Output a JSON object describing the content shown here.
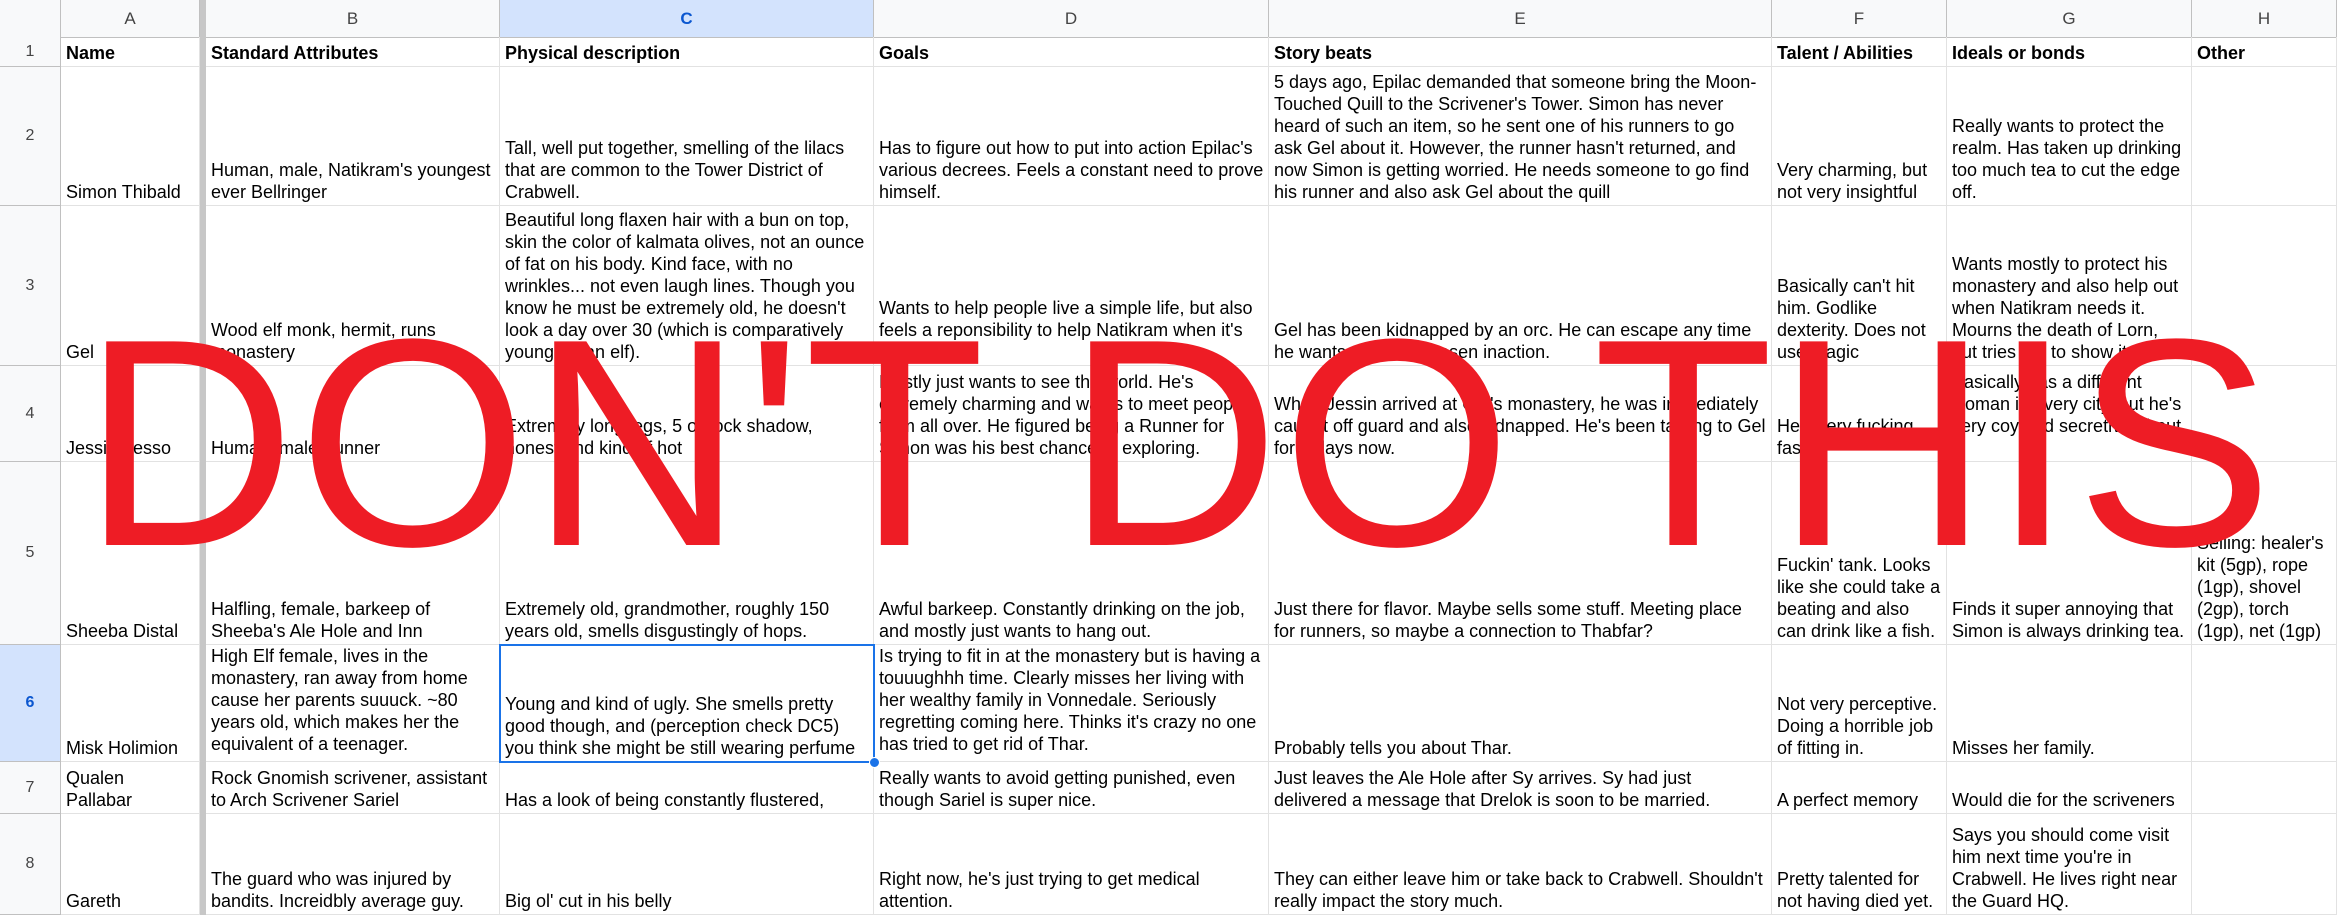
{
  "columns": [
    "A",
    "B",
    "C",
    "D",
    "E",
    "F",
    "G",
    "H"
  ],
  "selected_column": "C",
  "selected_row": "6",
  "header_row": {
    "row_number": "1",
    "cells": [
      "Name",
      "Standard Attributes",
      "Physical description",
      "Goals",
      "Story beats",
      "Talent / Abilities",
      "Ideals or bonds",
      "Other"
    ]
  },
  "rows": [
    {
      "row_number": "2",
      "cells": [
        "Simon Thibald",
        "Human, male, Natikram's youngest ever Bellringer",
        "Tall, well put together, smelling of the lilacs that are common to the Tower District of Crabwell.",
        "Has to figure out how to put into action Epilac's various decrees. Feels a constant need to prove himself.",
        "5 days ago, Epilac demanded that someone bring the Moon-Touched Quill to the Scrivener's Tower. Simon has never heard of such an item, so he sent one of his runners to go ask Gel about it. However, the runner hasn't returned, and now Simon is getting worried. He needs someone to go find his runner and also ask Gel about the quill",
        "Very charming, but not very insightful",
        "Really wants to protect the realm. Has taken up drinking too much tea to cut the edge off.",
        ""
      ]
    },
    {
      "row_number": "3",
      "cells": [
        "Gel",
        "Wood elf monk, hermit, runs monastery",
        "Beautiful long flaxen hair with a bun on top, skin the color of kalmata olives, not an ounce of fat on his body. Kind face, with no wrinkles... not even laugh lines. Though you know he must be extremely old, he doesn't look a day over 30 (which is comparatively young for an elf).",
        "Wants to help people live a simple life, but also feels a reponsibility to help Natikram when it's needed.",
        "Gel has been kidnapped by an orc. He can escape any time he wants, but has chosen inaction.",
        "Basically can't hit him. Godlike dexterity. Does not use magic",
        "Wants mostly to protect his monastery and also help out when Natikram needs it. Mourns the death of Lorn, but tries not to show it.",
        ""
      ]
    },
    {
      "row_number": "4",
      "cells": [
        "Jessin Fesso",
        "Human, male, runner",
        "Extremely long legs, 5 o'clock shadow, honest and kind of hot",
        "Mostly just wants to see the world. He's extremely charming and wants to meet people from all over. He figured being a Runner for Simon was his best chance of exploring.",
        "When Jessin arrived at Gel's monastery, he was immediately caught off guard and also kidnapped. He's been talking to Gel for 2 days now.",
        "He's very fucking fast.",
        "Basically has a different woman in every city, but he's very coy and secretive about it.",
        ""
      ]
    },
    {
      "row_number": "5",
      "cells": [
        "Sheeba Distal",
        "Halfling, female, barkeep of Sheeba's Ale Hole and Inn",
        "Extremely old, grandmother, roughly 150 years old, smells disgustingly of hops.",
        "Awful barkeep. Constantly drinking on the job, and mostly just wants to hang out.",
        "Just there for flavor. Maybe sells some stuff. Meeting place for runners, so maybe a connection to Thabfar?",
        "Fuckin' tank. Looks like she could take a beating and also can drink like a fish.",
        "Finds it super annoying that Simon is always drinking tea.",
        "Selling: healer's kit (5gp), rope (1gp), shovel (2gp), torch (1gp), net (1gp)"
      ]
    },
    {
      "row_number": "6",
      "cells": [
        "Misk Holimion",
        "High Elf female, lives in the monastery, ran away from home cause her parents suuuck. ~80 years old, which makes her the equivalent of a teenager.",
        "Young and kind of ugly. She smells pretty good though, and (perception check DC5) you think she might be still wearing perfume",
        "Is trying to fit in at the monastery but is having a touuughhh time. Clearly misses her living with her wealthy family in Vonnedale. Seriously regretting coming here. Thinks it's crazy no one has tried to get rid of Thar.",
        "Probably tells you about Thar.",
        "Not very perceptive. Doing a horrible job of fitting in.",
        "Misses her family.",
        ""
      ]
    },
    {
      "row_number": "7",
      "cells": [
        "Qualen Pallabar",
        "Rock Gnomish scrivener, assistant to Arch Scrivener Sariel",
        "Has a look of being constantly flustered,",
        "Really wants to avoid getting punished, even though Sariel is super nice.",
        "Just leaves the Ale Hole after Sy arrives. Sy had just delivered a message that Drelok is soon to be married.",
        "A perfect memory",
        "Would die for the scriveners",
        ""
      ]
    },
    {
      "row_number": "8",
      "cells": [
        "Gareth",
        "The guard who was injured by bandits. Increidbly average guy.",
        "Big ol' cut in his belly",
        "Right now, he's just trying to get medical attention.",
        "They can either leave him or take back to Crabwell. Shouldn't really impact the story much.",
        "Pretty talented for not having died yet.",
        "Says you should come visit him next time you're in Crabwell. He lives right near the Guard HQ.",
        ""
      ]
    }
  ],
  "overlay_text": "DON'T DO THIS",
  "colors": {
    "overlay": "#ee1c25",
    "selection": "#1a73e8",
    "selected_header_bg": "#d3e3fd",
    "header_bg": "#f8f9fa"
  }
}
